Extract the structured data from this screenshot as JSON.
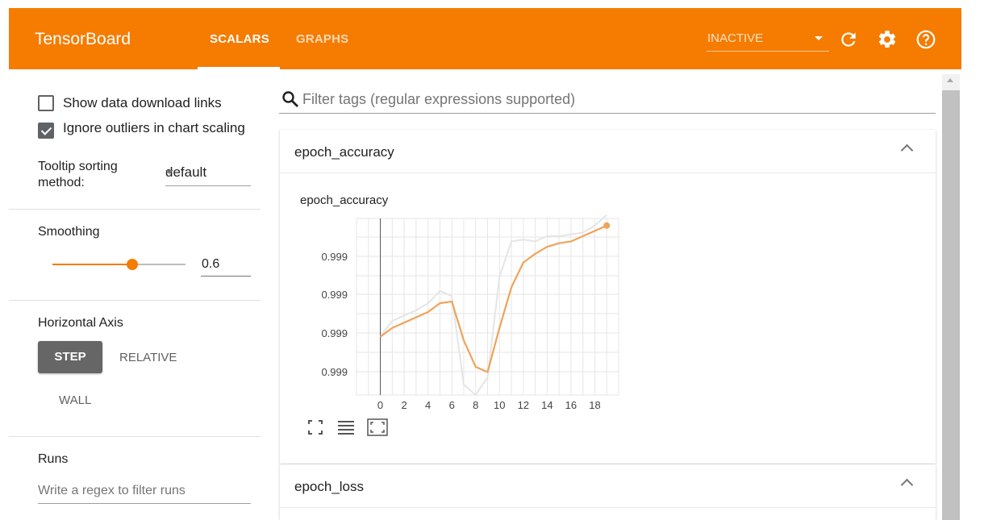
{
  "app": {
    "title": "TensorBoard"
  },
  "tabs": [
    {
      "label": "SCALARS"
    },
    {
      "label": "GRAPHS"
    }
  ],
  "status": {
    "label": "INACTIVE"
  },
  "icons": {
    "refresh": "refresh-icon",
    "settings": "gear-icon",
    "help": "help-icon",
    "search": "search-icon"
  },
  "colors": {
    "accent": "#f57c00",
    "smoothed": "#f0a35a",
    "raw": "#e5e5e5"
  },
  "sidebar": {
    "show_download_links": {
      "label": "Show data download links",
      "checked": false
    },
    "ignore_outliers": {
      "label": "Ignore outliers in chart scaling",
      "checked": true
    },
    "tooltip_sorting": {
      "label": "Tooltip sorting method:",
      "value": "default"
    },
    "smoothing": {
      "label": "Smoothing",
      "value": "0.6",
      "fraction": 0.6
    },
    "horizontal_axis": {
      "label": "Horizontal Axis",
      "options": [
        "STEP",
        "RELATIVE",
        "WALL"
      ],
      "selected": "STEP"
    },
    "runs": {
      "label": "Runs",
      "placeholder": "Write a regex to filter runs"
    }
  },
  "search": {
    "placeholder": "Filter tags (regular expressions supported)"
  },
  "cards": [
    {
      "title": "epoch_accuracy",
      "expanded": true
    },
    {
      "title": "epoch_loss",
      "expanded": true
    }
  ],
  "chart_data": {
    "type": "line",
    "title": "epoch_accuracy",
    "xlabel": "",
    "ylabel": "",
    "x_ticks": [
      0,
      2,
      4,
      6,
      8,
      10,
      12,
      14,
      16,
      18
    ],
    "y_tick_labels": [
      "0.999",
      "0.999",
      "0.999",
      "0.999"
    ],
    "xlim": [
      -2,
      20
    ],
    "ylim": [
      0.0,
      1.0
    ],
    "grid": true,
    "x": [
      0,
      1,
      2,
      3,
      4,
      5,
      6,
      7,
      8,
      9,
      10,
      11,
      12,
      13,
      14,
      15,
      16,
      17,
      18,
      19
    ],
    "series": [
      {
        "role": "raw",
        "values": [
          0.33,
          0.42,
          0.45,
          0.48,
          0.52,
          0.59,
          0.56,
          0.06,
          0.0,
          0.1,
          0.67,
          0.87,
          0.88,
          0.87,
          0.9,
          0.9,
          0.91,
          0.92,
          0.96,
          1.02
        ]
      },
      {
        "role": "smoothed",
        "values": [
          0.33,
          0.38,
          0.41,
          0.44,
          0.47,
          0.52,
          0.53,
          0.31,
          0.16,
          0.13,
          0.38,
          0.61,
          0.75,
          0.8,
          0.84,
          0.86,
          0.87,
          0.9,
          0.93,
          0.96
        ]
      }
    ]
  }
}
